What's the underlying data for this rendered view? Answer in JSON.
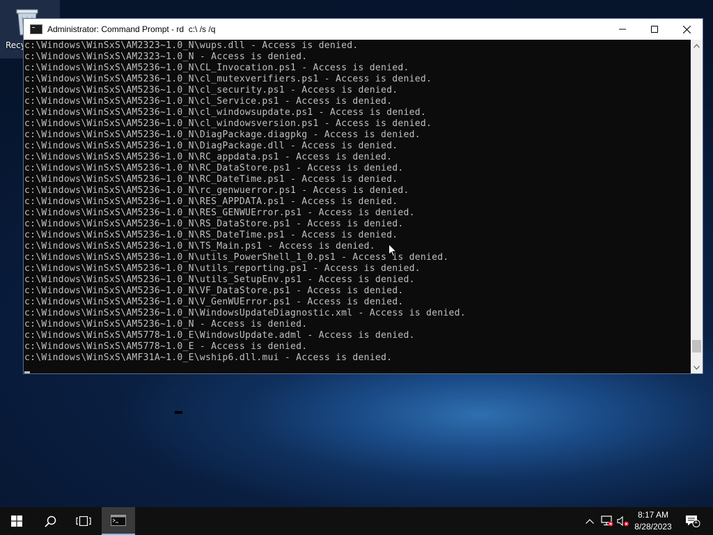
{
  "desktop": {
    "icons": [
      {
        "name": "recycle-bin",
        "label": "Recyc"
      }
    ]
  },
  "window": {
    "title": "Administrator: Command Prompt - rd  c:\\ /s /q",
    "controls": {
      "minimize": "minimize-icon",
      "maximize": "maximize-icon",
      "close": "close-icon"
    },
    "console_lines": [
      "c:\\Windows\\WinSxS\\AM2323~1.0_N\\wups.dll - Access is denied.",
      "c:\\Windows\\WinSxS\\AM2323~1.0_N - Access is denied.",
      "c:\\Windows\\WinSxS\\AM5236~1.0_N\\CL_Invocation.ps1 - Access is denied.",
      "c:\\Windows\\WinSxS\\AM5236~1.0_N\\cl_mutexverifiers.ps1 - Access is denied.",
      "c:\\Windows\\WinSxS\\AM5236~1.0_N\\cl_security.ps1 - Access is denied.",
      "c:\\Windows\\WinSxS\\AM5236~1.0_N\\cl_Service.ps1 - Access is denied.",
      "c:\\Windows\\WinSxS\\AM5236~1.0_N\\cl_windowsupdate.ps1 - Access is denied.",
      "c:\\Windows\\WinSxS\\AM5236~1.0_N\\cl_windowsversion.ps1 - Access is denied.",
      "c:\\Windows\\WinSxS\\AM5236~1.0_N\\DiagPackage.diagpkg - Access is denied.",
      "c:\\Windows\\WinSxS\\AM5236~1.0_N\\DiagPackage.dll - Access is denied.",
      "c:\\Windows\\WinSxS\\AM5236~1.0_N\\RC_appdata.ps1 - Access is denied.",
      "c:\\Windows\\WinSxS\\AM5236~1.0_N\\RC_DataStore.ps1 - Access is denied.",
      "c:\\Windows\\WinSxS\\AM5236~1.0_N\\RC_DateTime.ps1 - Access is denied.",
      "c:\\Windows\\WinSxS\\AM5236~1.0_N\\rc_genwuerror.ps1 - Access is denied.",
      "c:\\Windows\\WinSxS\\AM5236~1.0_N\\RES_APPDATA.ps1 - Access is denied.",
      "c:\\Windows\\WinSxS\\AM5236~1.0_N\\RES_GENWUError.ps1 - Access is denied.",
      "c:\\Windows\\WinSxS\\AM5236~1.0_N\\RS_DataStore.ps1 - Access is denied.",
      "c:\\Windows\\WinSxS\\AM5236~1.0_N\\RS_DateTime.ps1 - Access is denied.",
      "c:\\Windows\\WinSxS\\AM5236~1.0_N\\TS_Main.ps1 - Access is denied.",
      "c:\\Windows\\WinSxS\\AM5236~1.0_N\\utils_PowerShell_1_0.ps1 - Access is denied.",
      "c:\\Windows\\WinSxS\\AM5236~1.0_N\\utils_reporting.ps1 - Access is denied.",
      "c:\\Windows\\WinSxS\\AM5236~1.0_N\\utils_SetupEnv.ps1 - Access is denied.",
      "c:\\Windows\\WinSxS\\AM5236~1.0_N\\VF_DataStore.ps1 - Access is denied.",
      "c:\\Windows\\WinSxS\\AM5236~1.0_N\\V_GenWUError.ps1 - Access is denied.",
      "c:\\Windows\\WinSxS\\AM5236~1.0_N\\WindowsUpdateDiagnostic.xml - Access is denied.",
      "c:\\Windows\\WinSxS\\AM5236~1.0_N - Access is denied.",
      "c:\\Windows\\WinSxS\\AM5778~1.0_E\\WindowsUpdate.adml - Access is denied.",
      "c:\\Windows\\WinSxS\\AM5778~1.0_E - Access is denied.",
      "c:\\Windows\\WinSxS\\AMF31A~1.0_E\\wship6.dll.mui - Access is denied."
    ],
    "scroll_position": 0.97
  },
  "taskbar": {
    "buttons": [
      "start-icon",
      "search-icon",
      "task-view-icon",
      "command-prompt-icon"
    ],
    "tray": [
      "chevron-up-icon",
      "network-icon",
      "volume-icon",
      "notification-icon"
    ],
    "time": "8:17 AM",
    "date": "8/28/2023",
    "notification_count": "1"
  },
  "colors": {
    "console_bg": "#0c0c0c",
    "console_fg": "#c0c0c0",
    "taskbar_bg": "#101010",
    "accent": "#76b9ed",
    "error_badge": "#e81123"
  }
}
